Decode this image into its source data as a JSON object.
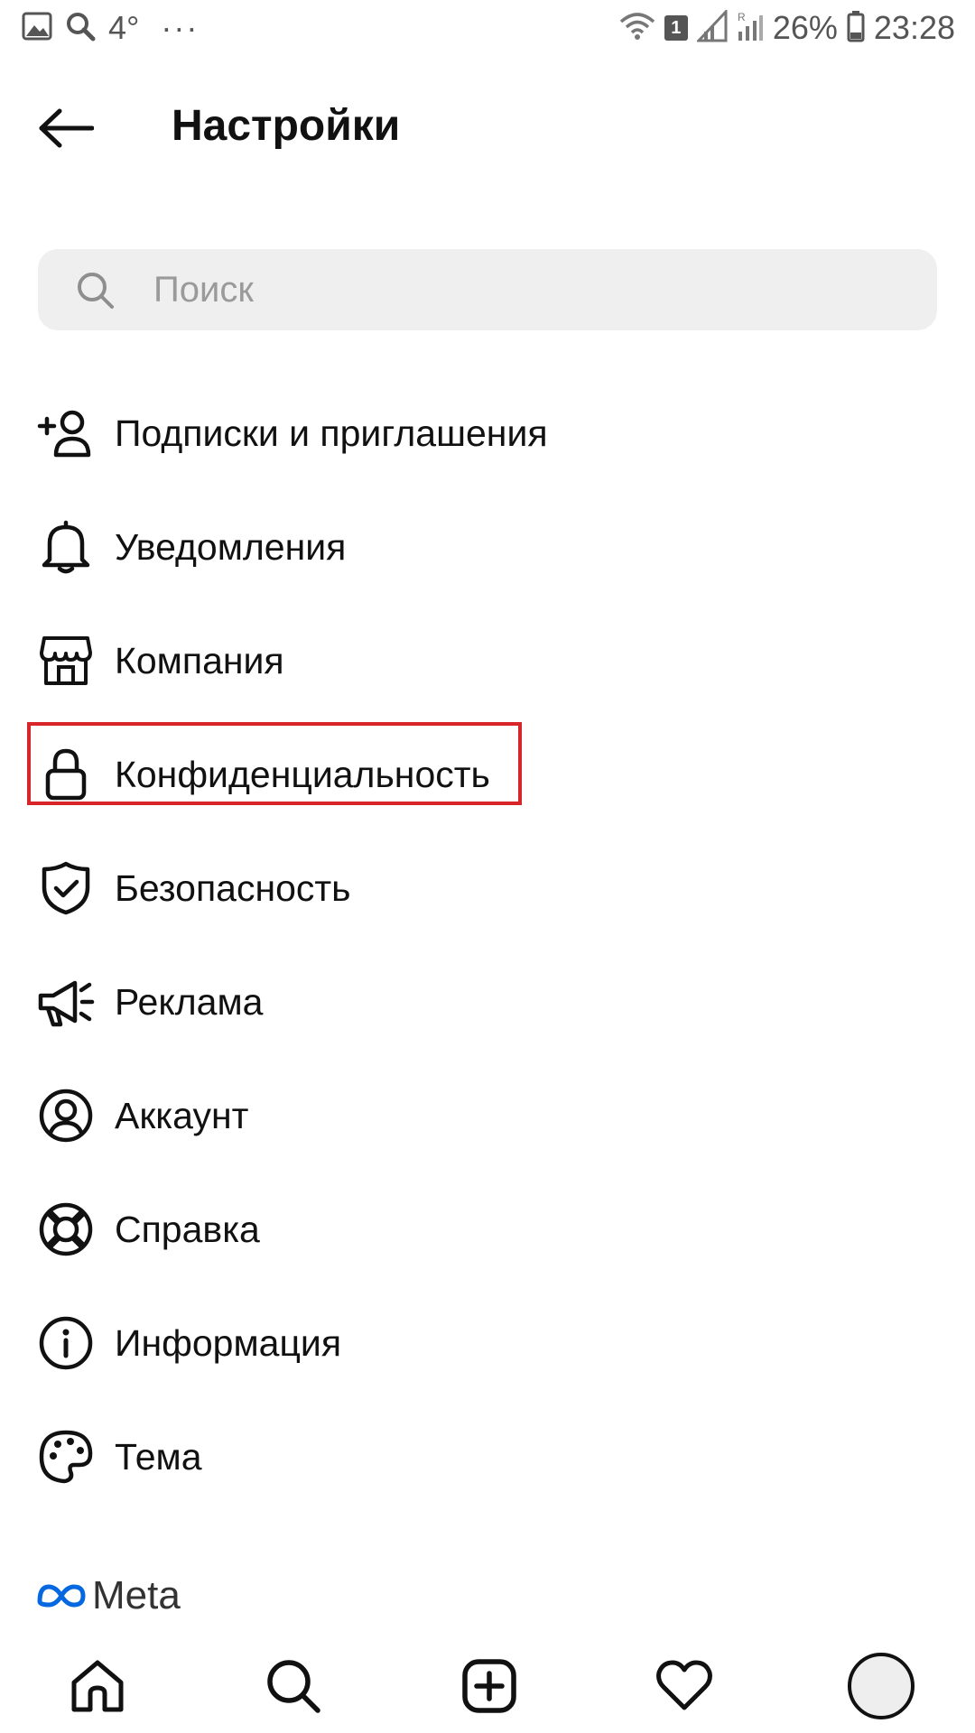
{
  "status_bar": {
    "temperature": "4°",
    "more": "···",
    "sim_badge": "1",
    "battery": "26%",
    "time": "23:28"
  },
  "header": {
    "title": "Настройки"
  },
  "search": {
    "placeholder": "Поиск",
    "value": ""
  },
  "menu": {
    "items": [
      {
        "label": "Подписки и приглашения",
        "icon": "add-person-icon"
      },
      {
        "label": "Уведомления",
        "icon": "bell-icon"
      },
      {
        "label": "Компания",
        "icon": "store-icon"
      },
      {
        "label": "Конфиденциальность",
        "icon": "lock-icon",
        "highlighted": true
      },
      {
        "label": "Безопасность",
        "icon": "shield-check-icon"
      },
      {
        "label": "Реклама",
        "icon": "megaphone-icon"
      },
      {
        "label": "Аккаунт",
        "icon": "account-circle-icon"
      },
      {
        "label": "Справка",
        "icon": "lifebuoy-icon"
      },
      {
        "label": "Информация",
        "icon": "info-icon"
      },
      {
        "label": "Тема",
        "icon": "palette-icon"
      }
    ]
  },
  "footer": {
    "brand": "Meta"
  },
  "bottom_nav": {
    "items": [
      "home-icon",
      "search-icon",
      "new-post-icon",
      "activity-heart-icon",
      "profile-avatar"
    ]
  },
  "colors": {
    "highlight": "#d7252a",
    "search_bg": "#efefef",
    "meta_blue": "#0668E1"
  }
}
